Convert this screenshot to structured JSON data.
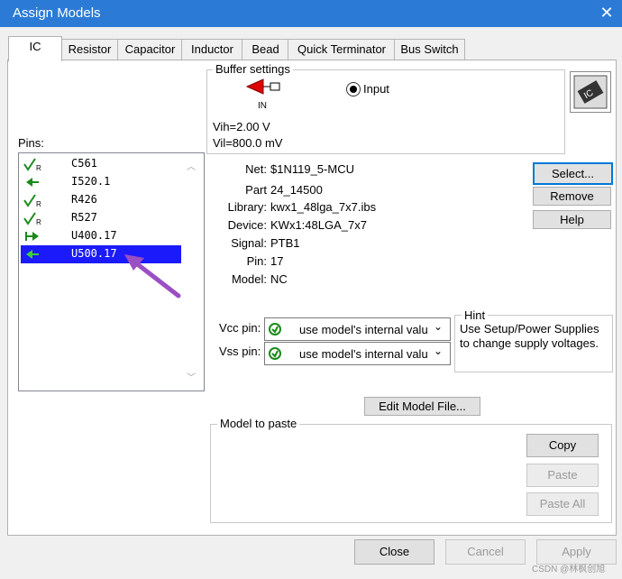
{
  "window": {
    "title": "Assign Models",
    "close_glyph": "✕"
  },
  "tabs": [
    {
      "label": "IC"
    },
    {
      "label": "Resistor"
    },
    {
      "label": "Capacitor"
    },
    {
      "label": "Inductor"
    },
    {
      "label": "Bead"
    },
    {
      "label": "Quick Terminator"
    },
    {
      "label": "Bus Switch"
    }
  ],
  "buffer": {
    "title": "Buffer settings",
    "symbol_label": "IN",
    "mode_label": "Input",
    "vih": "Vih=2.00 V",
    "vil": "Vil=800.0 mV"
  },
  "pins": {
    "label": "Pins:",
    "items": [
      {
        "name": "C561",
        "icon": "resistor-arrow-icon"
      },
      {
        "name": "I520.1",
        "icon": "input-arrow-icon"
      },
      {
        "name": "R426",
        "icon": "resistor-arrow-icon"
      },
      {
        "name": "R527",
        "icon": "resistor-arrow-icon"
      },
      {
        "name": "U400.17",
        "icon": "output-arrow-icon"
      },
      {
        "name": "U500.17",
        "icon": "input-arrow-icon",
        "selected": true
      }
    ]
  },
  "details": {
    "net_label": "Net:",
    "net_value": "$1N119_5-MCU",
    "part_label": "Part",
    "part_value": "24_14500",
    "library_label": "Library:",
    "library_value": "kwx1_48lga_7x7.ibs",
    "device_label": "Device:",
    "device_value": "KWx1:48LGA_7x7",
    "signal_label": "Signal:",
    "signal_value": "PTB1",
    "pin_label": "Pin:",
    "pin_value": "17",
    "model_label": "Model:",
    "model_value": "NC"
  },
  "actions": {
    "select": "Select...",
    "remove": "Remove",
    "help": "Help"
  },
  "supply": {
    "vcc_label": "Vcc pin:",
    "vcc_value": "use model's internal valu",
    "vss_label": "Vss pin:",
    "vss_value": "use model's internal valu"
  },
  "hint": {
    "title": "Hint",
    "text_line1": "Use Setup/Power Supplies",
    "text_line2": "to change supply voltages."
  },
  "edit_model": "Edit Model File...",
  "paste": {
    "title": "Model to paste",
    "copy": "Copy",
    "paste": "Paste",
    "paste_all": "Paste All"
  },
  "footer": {
    "close": "Close",
    "cancel": "Cancel",
    "apply": "Apply"
  },
  "watermark": "CSDN @林枫创旭",
  "colors": {
    "titlebar": "#2b7bd6",
    "selection": "#1a1afa",
    "red_symbol": "#e00000",
    "icon_green": "#1a8a1a",
    "annotation_arrow": "#9b4fc4"
  }
}
